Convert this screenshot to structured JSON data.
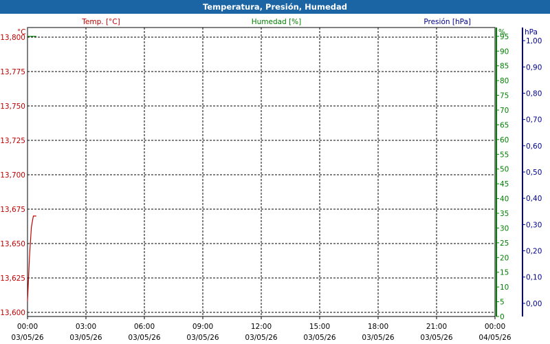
{
  "window": {
    "title": "Temperatura, Presión, Humedad",
    "title_bar_color": "#1b65a5"
  },
  "chart_data": {
    "type": "line",
    "title": "Temperatura, Presión, Humedad",
    "x": {
      "ticks": [
        {
          "time": "00:00",
          "date": "03/05/26"
        },
        {
          "time": "03:00",
          "date": "03/05/26"
        },
        {
          "time": "06:00",
          "date": "03/05/26"
        },
        {
          "time": "09:00",
          "date": "03/05/26"
        },
        {
          "time": "12:00",
          "date": "03/05/26"
        },
        {
          "time": "15:00",
          "date": "03/05/26"
        },
        {
          "time": "18:00",
          "date": "03/05/26"
        },
        {
          "time": "21:00",
          "date": "03/05/26"
        },
        {
          "time": "00:00",
          "date": "04/05/26"
        }
      ],
      "range_hours": [
        0,
        24
      ],
      "grid": true
    },
    "axes": {
      "temperature": {
        "label": "Temp. [°C]",
        "unit": "°C",
        "side": "left",
        "color": "#c00000",
        "range": [
          13.597,
          13.807
        ],
        "ticks": [
          "13,600",
          "13,625",
          "13,650",
          "13,675",
          "13,700",
          "13,725",
          "13,750",
          "13,775",
          "13,800"
        ],
        "tick_values": [
          13.6,
          13.625,
          13.65,
          13.675,
          13.7,
          13.725,
          13.75,
          13.775,
          13.8
        ]
      },
      "humidity": {
        "label": "Humedad [%]",
        "unit": "%",
        "side": "right",
        "color": "#008000",
        "range": [
          0,
          98
        ],
        "ticks": [
          "0",
          "5",
          "10",
          "15",
          "20",
          "25",
          "30",
          "35",
          "40",
          "45",
          "50",
          "55",
          "60",
          "65",
          "70",
          "75",
          "80",
          "85",
          "90",
          "95"
        ],
        "tick_values": [
          0,
          5,
          10,
          15,
          20,
          25,
          30,
          35,
          40,
          45,
          50,
          55,
          60,
          65,
          70,
          75,
          80,
          85,
          90,
          95
        ]
      },
      "pressure": {
        "label": "Presión [hPa]",
        "unit": "hPa",
        "side": "right",
        "color": "#00008b",
        "range": [
          -0.05,
          1.05
        ],
        "ticks": [
          "0,00",
          "0,10",
          "0,20",
          "0,30",
          "0,40",
          "0,50",
          "0,60",
          "0,70",
          "0,80",
          "0,90",
          "1,00"
        ],
        "tick_values": [
          0,
          0.1,
          0.2,
          0.3,
          0.4,
          0.5,
          0.6,
          0.7,
          0.8,
          0.9,
          1.0
        ]
      }
    },
    "series": [
      {
        "axis": "temperature",
        "color": "#c00000",
        "points": [
          [
            0.0,
            13.608
          ],
          [
            0.1,
            13.64
          ],
          [
            0.2,
            13.662
          ],
          [
            0.3,
            13.67
          ],
          [
            0.45,
            13.67
          ]
        ]
      },
      {
        "axis": "humidity",
        "color": "#008000",
        "points": [
          [
            0.0,
            95.0
          ],
          [
            0.45,
            95.0
          ]
        ]
      }
    ]
  }
}
